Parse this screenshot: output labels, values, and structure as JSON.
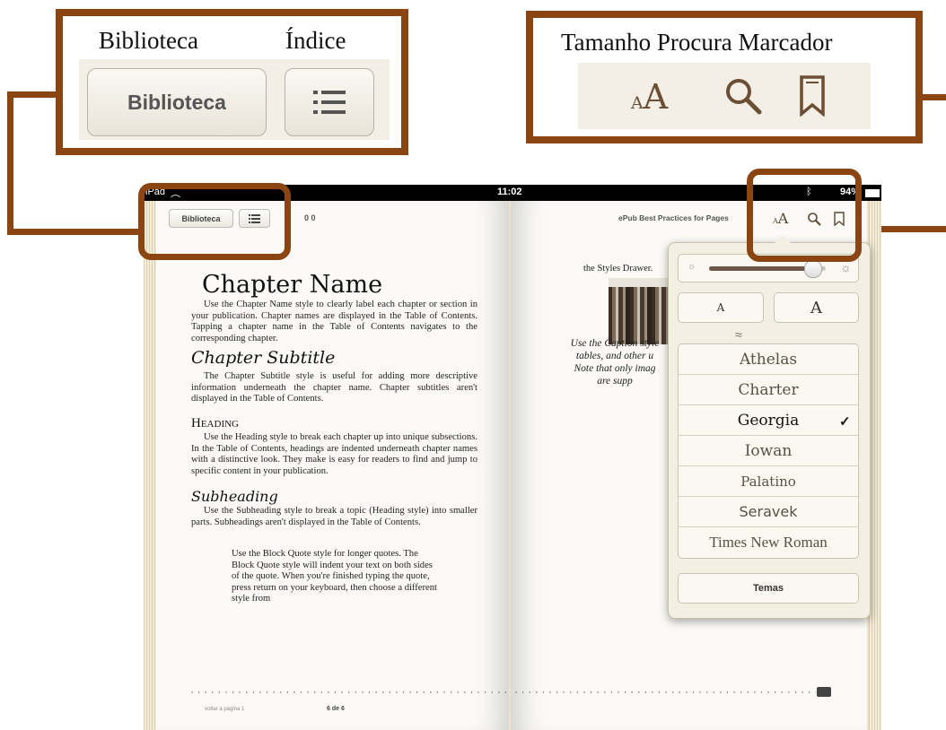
{
  "callouts": {
    "left": {
      "label_library": "Biblioteca",
      "label_index": "Índice",
      "library_button": "Biblioteca",
      "index_icon": "list-icon"
    },
    "right": {
      "labels": "Tamanho Procura Marcador",
      "icons": [
        "font-size-icon",
        "search-icon",
        "bookmark-icon"
      ],
      "font_icon_text": "AA"
    }
  },
  "status_bar": {
    "device": "iPad",
    "time": "11:02",
    "battery": "94%"
  },
  "toolbar": {
    "library_button": "Biblioteca",
    "left_page_number": "0 0",
    "book_title": "ePub Best Practices for Pages"
  },
  "left_page": {
    "chapter_name": "Chapter Name",
    "chapter_name_text": "Use the Chapter Name style to clearly label each chapter or section in your publication. Chapter names are displayed in the Table of Contents. Tapping a chapter name in the Table of Contents navigates to the corresponding chapter.",
    "chapter_subtitle": "Chapter Subtitle",
    "chapter_subtitle_text": "The Chapter Subtitle style is useful for adding more descriptive information underneath the chapter name. Chapter subtitles aren't displayed in the Table of Contents.",
    "heading": "Heading",
    "heading_text": "Use the Heading style to break each chapter up into unique subsections. In the Table of Contents, headings are indented underneath chapter names with a distinctive look. They make is easy for readers to find and jump to specific content in your publication.",
    "subheading": "Subheading",
    "subheading_text": "Use the Subheading style to break a topic (Heading style) into smaller parts. Subheadings aren't displayed in the Table of Contents.",
    "block_quote": "Use the Block Quote style for longer quotes. The Block Quote style will indent your text on both sides of the quote. When you're finished typing the quote, press return on your keyboard, then choose a different style from",
    "back_link": "voltar à página 1",
    "page_indicator": "6 de 6"
  },
  "right_page": {
    "text_top": "the Styles Drawer.",
    "caption_lines": [
      "Use the Caption style",
      "tables, and other u",
      "Note that only imag",
      "are supp"
    ]
  },
  "popover": {
    "font_small": "A",
    "font_large": "A",
    "brightness": 0.88,
    "fonts": [
      "Athelas",
      "Charter",
      "Georgia",
      "Iowan",
      "Palatino",
      "Seravek",
      "Times New Roman"
    ],
    "selected_font": "Georgia",
    "checkmark": "✓",
    "themes_button": "Temas"
  },
  "colors": {
    "callout_border": "#8b4513",
    "bookmark_color": "#8a6a45"
  }
}
